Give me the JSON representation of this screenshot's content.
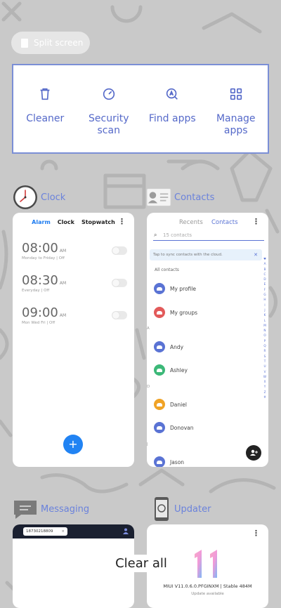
{
  "top": {
    "split_label": "Split screen"
  },
  "tools": [
    {
      "label": "Cleaner",
      "icon": "trash-icon"
    },
    {
      "label": "Security scan",
      "icon": "gauge-icon"
    },
    {
      "label": "Find apps",
      "icon": "find-apps-icon"
    },
    {
      "label": "Manage apps",
      "icon": "grid-icon"
    }
  ],
  "apps": {
    "clock": {
      "title": "Clock",
      "tabs": [
        "Alarm",
        "Clock",
        "Stopwatch"
      ],
      "alarms": [
        {
          "time": "08:00",
          "ampm": "AM",
          "sub": "Monday to Friday | Off"
        },
        {
          "time": "08:30",
          "ampm": "AM",
          "sub": "Everyday | Off"
        },
        {
          "time": "09:00",
          "ampm": "AM",
          "sub": "Mon Wed Fri | Off"
        }
      ],
      "fab": "+"
    },
    "contacts": {
      "title": "Contacts",
      "tab_recents": "Recents",
      "tab_contacts": "Contacts",
      "search_placeholder": "15 contacts",
      "sync_text": "Tap to sync contacts with the cloud.",
      "all_contacts": "All contacts",
      "rows": [
        {
          "name": "My profile",
          "color": "#5a73d4"
        },
        {
          "name": "My groups",
          "color": "#e25a5a"
        },
        {
          "name": "Andy",
          "color": "#5a73d4"
        },
        {
          "name": "Ashley",
          "color": "#3cb878"
        },
        {
          "name": "Daniel",
          "color": "#f0a326"
        },
        {
          "name": "Donovan",
          "color": "#5a73d4"
        },
        {
          "name": "Jason",
          "color": "#5a73d4"
        }
      ],
      "letters": [
        "A",
        "D",
        "J"
      ],
      "alphabet": [
        "♥",
        "A",
        "B",
        "C",
        "D",
        "E",
        "F",
        "G",
        "H",
        "I",
        "J",
        "K",
        "L",
        "M",
        "N",
        "O",
        "P",
        "Q",
        "R",
        "S",
        "T",
        "U",
        "V",
        "W",
        "X",
        "Y",
        "Z",
        "#"
      ]
    },
    "messaging": {
      "title": "Messaging",
      "chip": "18730218809",
      "chip_close": "×"
    },
    "updater": {
      "title": "Updater",
      "version": "MIUI V11.0.6.0.PFGINXM | Stable 484M",
      "status": "Update available"
    }
  },
  "clear_all": "Clear all",
  "colors": {
    "accent": "#5569c9",
    "blue": "#2183f3",
    "background": "#c9c9c9"
  }
}
